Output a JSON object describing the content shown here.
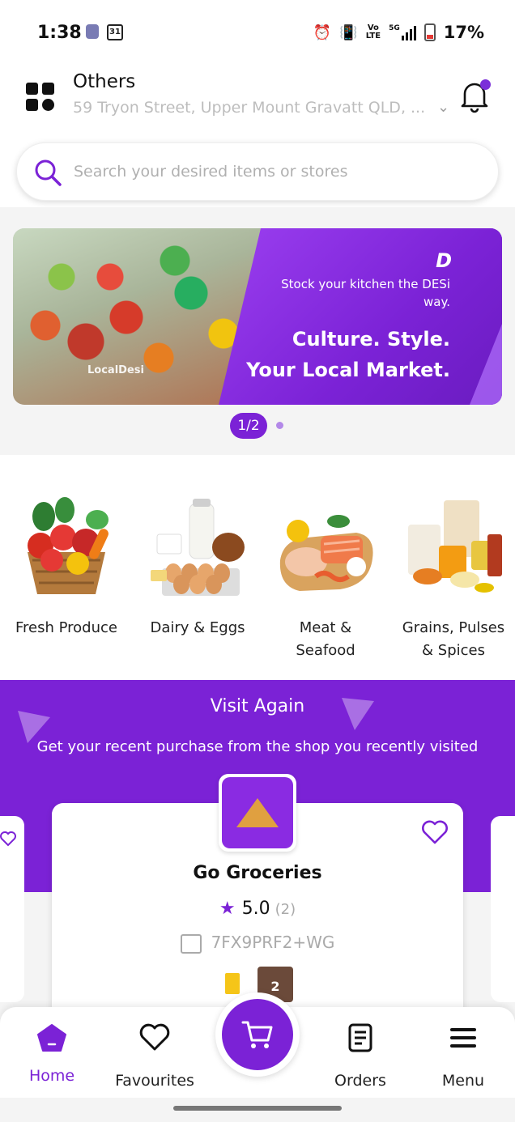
{
  "status_bar": {
    "time": "1:38",
    "calendar_day": "31",
    "network_volte": "Vo\nLTE",
    "network_5g": "5G",
    "battery_percent": "17%"
  },
  "header": {
    "location_title": "Others",
    "location_address": "59 Tryon Street, Upper Mount Gravatt QLD, ...",
    "search_placeholder": "Search your desired items or stores"
  },
  "banner": {
    "logo_text": "D",
    "watermark": "LocalDesi",
    "subtitle": "Stock your kitchen the DESi way.",
    "title_line1": "Culture. Style.",
    "title_line2": "Your Local Market.",
    "pager": "1/2"
  },
  "categories": [
    {
      "label": "Fresh Produce"
    },
    {
      "label": "Dairy & Eggs"
    },
    {
      "label": "Meat & Seafood"
    },
    {
      "label": "Grains, Pulses & Spices"
    }
  ],
  "visit_again": {
    "title": "Visit Again",
    "subtitle": "Get your recent purchase from the shop you recently visited",
    "store": {
      "name": "Go Groceries",
      "rating": "5.0",
      "rating_count": "(2)",
      "plus_code": "7FX9PRF2+WG",
      "product_badge": "2"
    }
  },
  "bottom_nav": {
    "home": "Home",
    "favourites": "Favourites",
    "orders": "Orders",
    "menu": "Menu"
  },
  "colors": {
    "brand_purple": "#7b22d6",
    "notification_dot": "#7b2fd9"
  },
  "icons": [
    "grid-icon",
    "chevron-down-icon",
    "bell-icon",
    "search-icon",
    "heart-icon",
    "star-icon",
    "store-icon",
    "home-icon",
    "cart-icon",
    "orders-icon",
    "menu-icon"
  ]
}
